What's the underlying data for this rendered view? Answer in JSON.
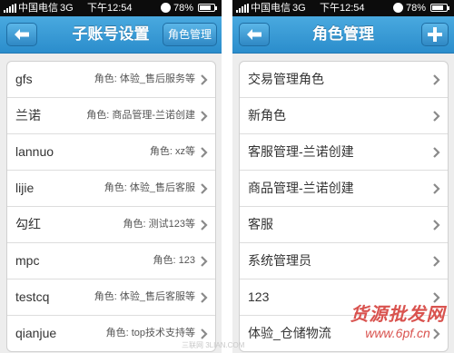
{
  "status_bar": {
    "carrier": "中国电信",
    "network": "3G",
    "time": "下午12:54",
    "battery": "78%",
    "battery_level": 0.78
  },
  "left_screen": {
    "title": "子账号设置",
    "action_label": "角色管理",
    "accounts": [
      {
        "name": "gfs",
        "role": "角色: 体验_售后服务等"
      },
      {
        "name": "兰诺",
        "role": "角色: 商品管理-兰诺创建"
      },
      {
        "name": "lannuo",
        "role": "角色: xz等"
      },
      {
        "name": "lijie",
        "role": "角色: 体验_售后客服"
      },
      {
        "name": "勾红",
        "role": "角色: 测试123等"
      },
      {
        "name": "mpc",
        "role": "角色: 123"
      },
      {
        "name": "testcq",
        "role": "角色: 体验_售后客服等"
      },
      {
        "name": "qianjue",
        "role": "角色: top技术支持等"
      }
    ]
  },
  "right_screen": {
    "title": "角色管理",
    "roles": [
      {
        "name": "交易管理角色"
      },
      {
        "name": "新角色"
      },
      {
        "name": "客服管理-兰诺创建"
      },
      {
        "name": "商品管理-兰诺创建"
      },
      {
        "name": "客服"
      },
      {
        "name": "系统管理员"
      },
      {
        "name": "123"
      },
      {
        "name": "体验_仓储物流"
      }
    ]
  },
  "watermark": {
    "site_name": "货源批发网",
    "site_url": "www.6pf.cn",
    "bottom_text": "三联网 3LIAN.COM"
  },
  "icons": {
    "back": "back-arrow-icon",
    "add": "plus-icon",
    "chevron": "chevron-right-icon",
    "lock": "orientation-lock-icon",
    "battery": "battery-icon",
    "signal": "signal-bars-icon"
  }
}
